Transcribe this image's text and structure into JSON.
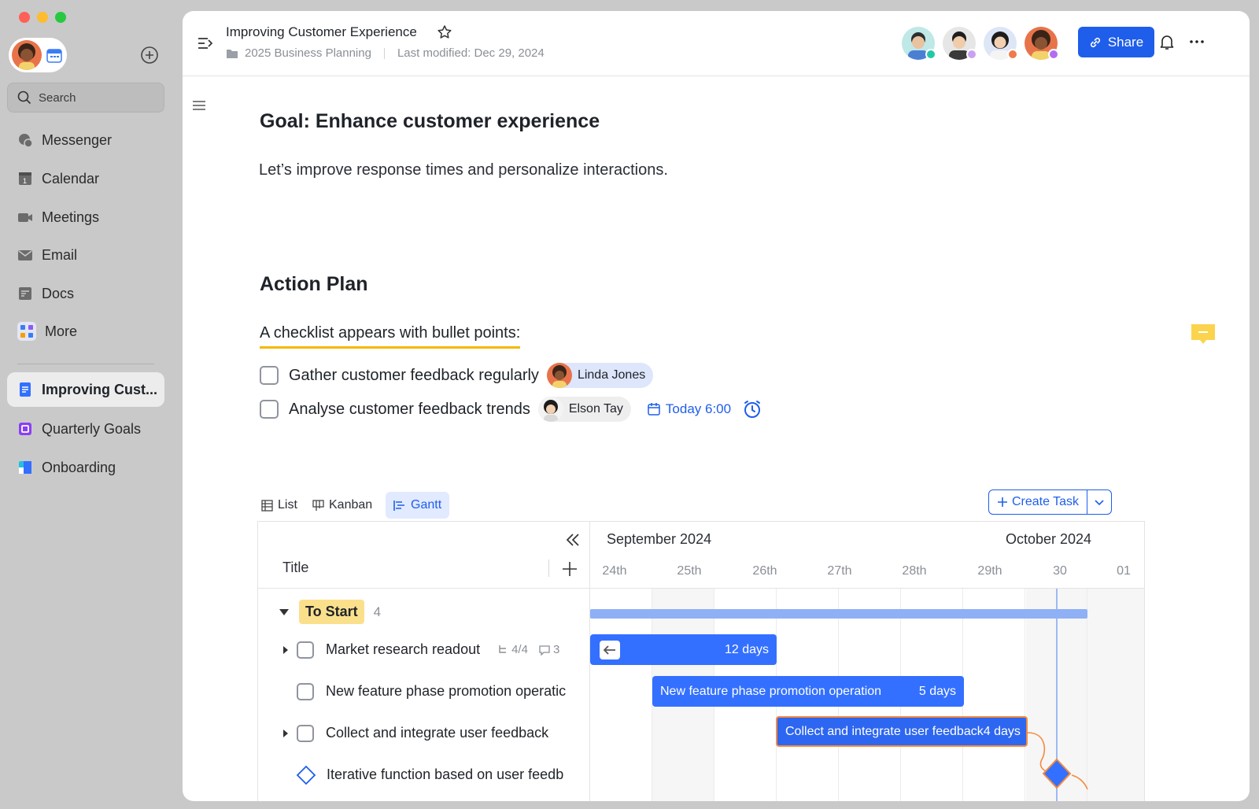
{
  "window": {
    "traffic_lights": [
      "#ff5f57",
      "#febc2e",
      "#28c840"
    ]
  },
  "sidebar": {
    "search_placeholder": "Search",
    "nav": [
      {
        "label": "Messenger",
        "icon": "messenger-icon"
      },
      {
        "label": "Calendar",
        "icon": "calendar-icon"
      },
      {
        "label": "Meetings",
        "icon": "video-icon"
      },
      {
        "label": "Email",
        "icon": "mail-icon"
      },
      {
        "label": "Docs",
        "icon": "docs-icon"
      },
      {
        "label": "More",
        "icon": "apps-icon"
      }
    ],
    "pinned": [
      {
        "label": "Improving Cust...",
        "icon": "doc-icon",
        "active": true
      },
      {
        "label": "Quarterly Goals",
        "icon": "goals-icon"
      },
      {
        "label": "Onboarding",
        "icon": "onboarding-icon"
      }
    ]
  },
  "header": {
    "title": "Improving Customer Experience",
    "folder": "2025 Business Planning",
    "modified": "Last modified: Dec 29, 2024",
    "share_label": "Share",
    "accent": "#1f5eea"
  },
  "doc": {
    "goal_heading": "Goal: Enhance customer experience",
    "goal_text": "Let’s improve response times and personalize interactions.",
    "plan_heading": "Action Plan",
    "checklist_intro": "A checklist appears with bullet points:",
    "tasks": [
      {
        "text": "Gather customer feedback regularly",
        "assignee": "Linda Jones"
      },
      {
        "text": "Analyse customer feedback trends",
        "assignee": "Elson Tay",
        "due": "Today 6:00"
      }
    ]
  },
  "views": {
    "tabs": [
      {
        "label": "List",
        "icon": "table-icon"
      },
      {
        "label": "Kanban",
        "icon": "kanban-icon"
      },
      {
        "label": "Gantt",
        "icon": "gantt-icon",
        "active": true
      }
    ],
    "create_task": "Create Task"
  },
  "gantt": {
    "title_col": "Title",
    "months": [
      "September 2024",
      "October 2024"
    ],
    "days": [
      "24th",
      "25th",
      "26th",
      "27th",
      "28th",
      "29th",
      "30",
      "01"
    ],
    "group": {
      "label": "To Start",
      "count": "4"
    },
    "rows": [
      {
        "title": "Market research readout",
        "subtasks": "4/4",
        "comments": "3",
        "bar_duration": "12 days"
      },
      {
        "title": "New feature phase promotion operatic",
        "bar_label": "New feature phase promotion operation",
        "bar_duration": "5 days"
      },
      {
        "title": "Collect and integrate user feedback",
        "bar_label": "Collect and integrate user feedback",
        "bar_duration": "4 days"
      },
      {
        "title": "Iterative function based on user feedb"
      }
    ]
  }
}
